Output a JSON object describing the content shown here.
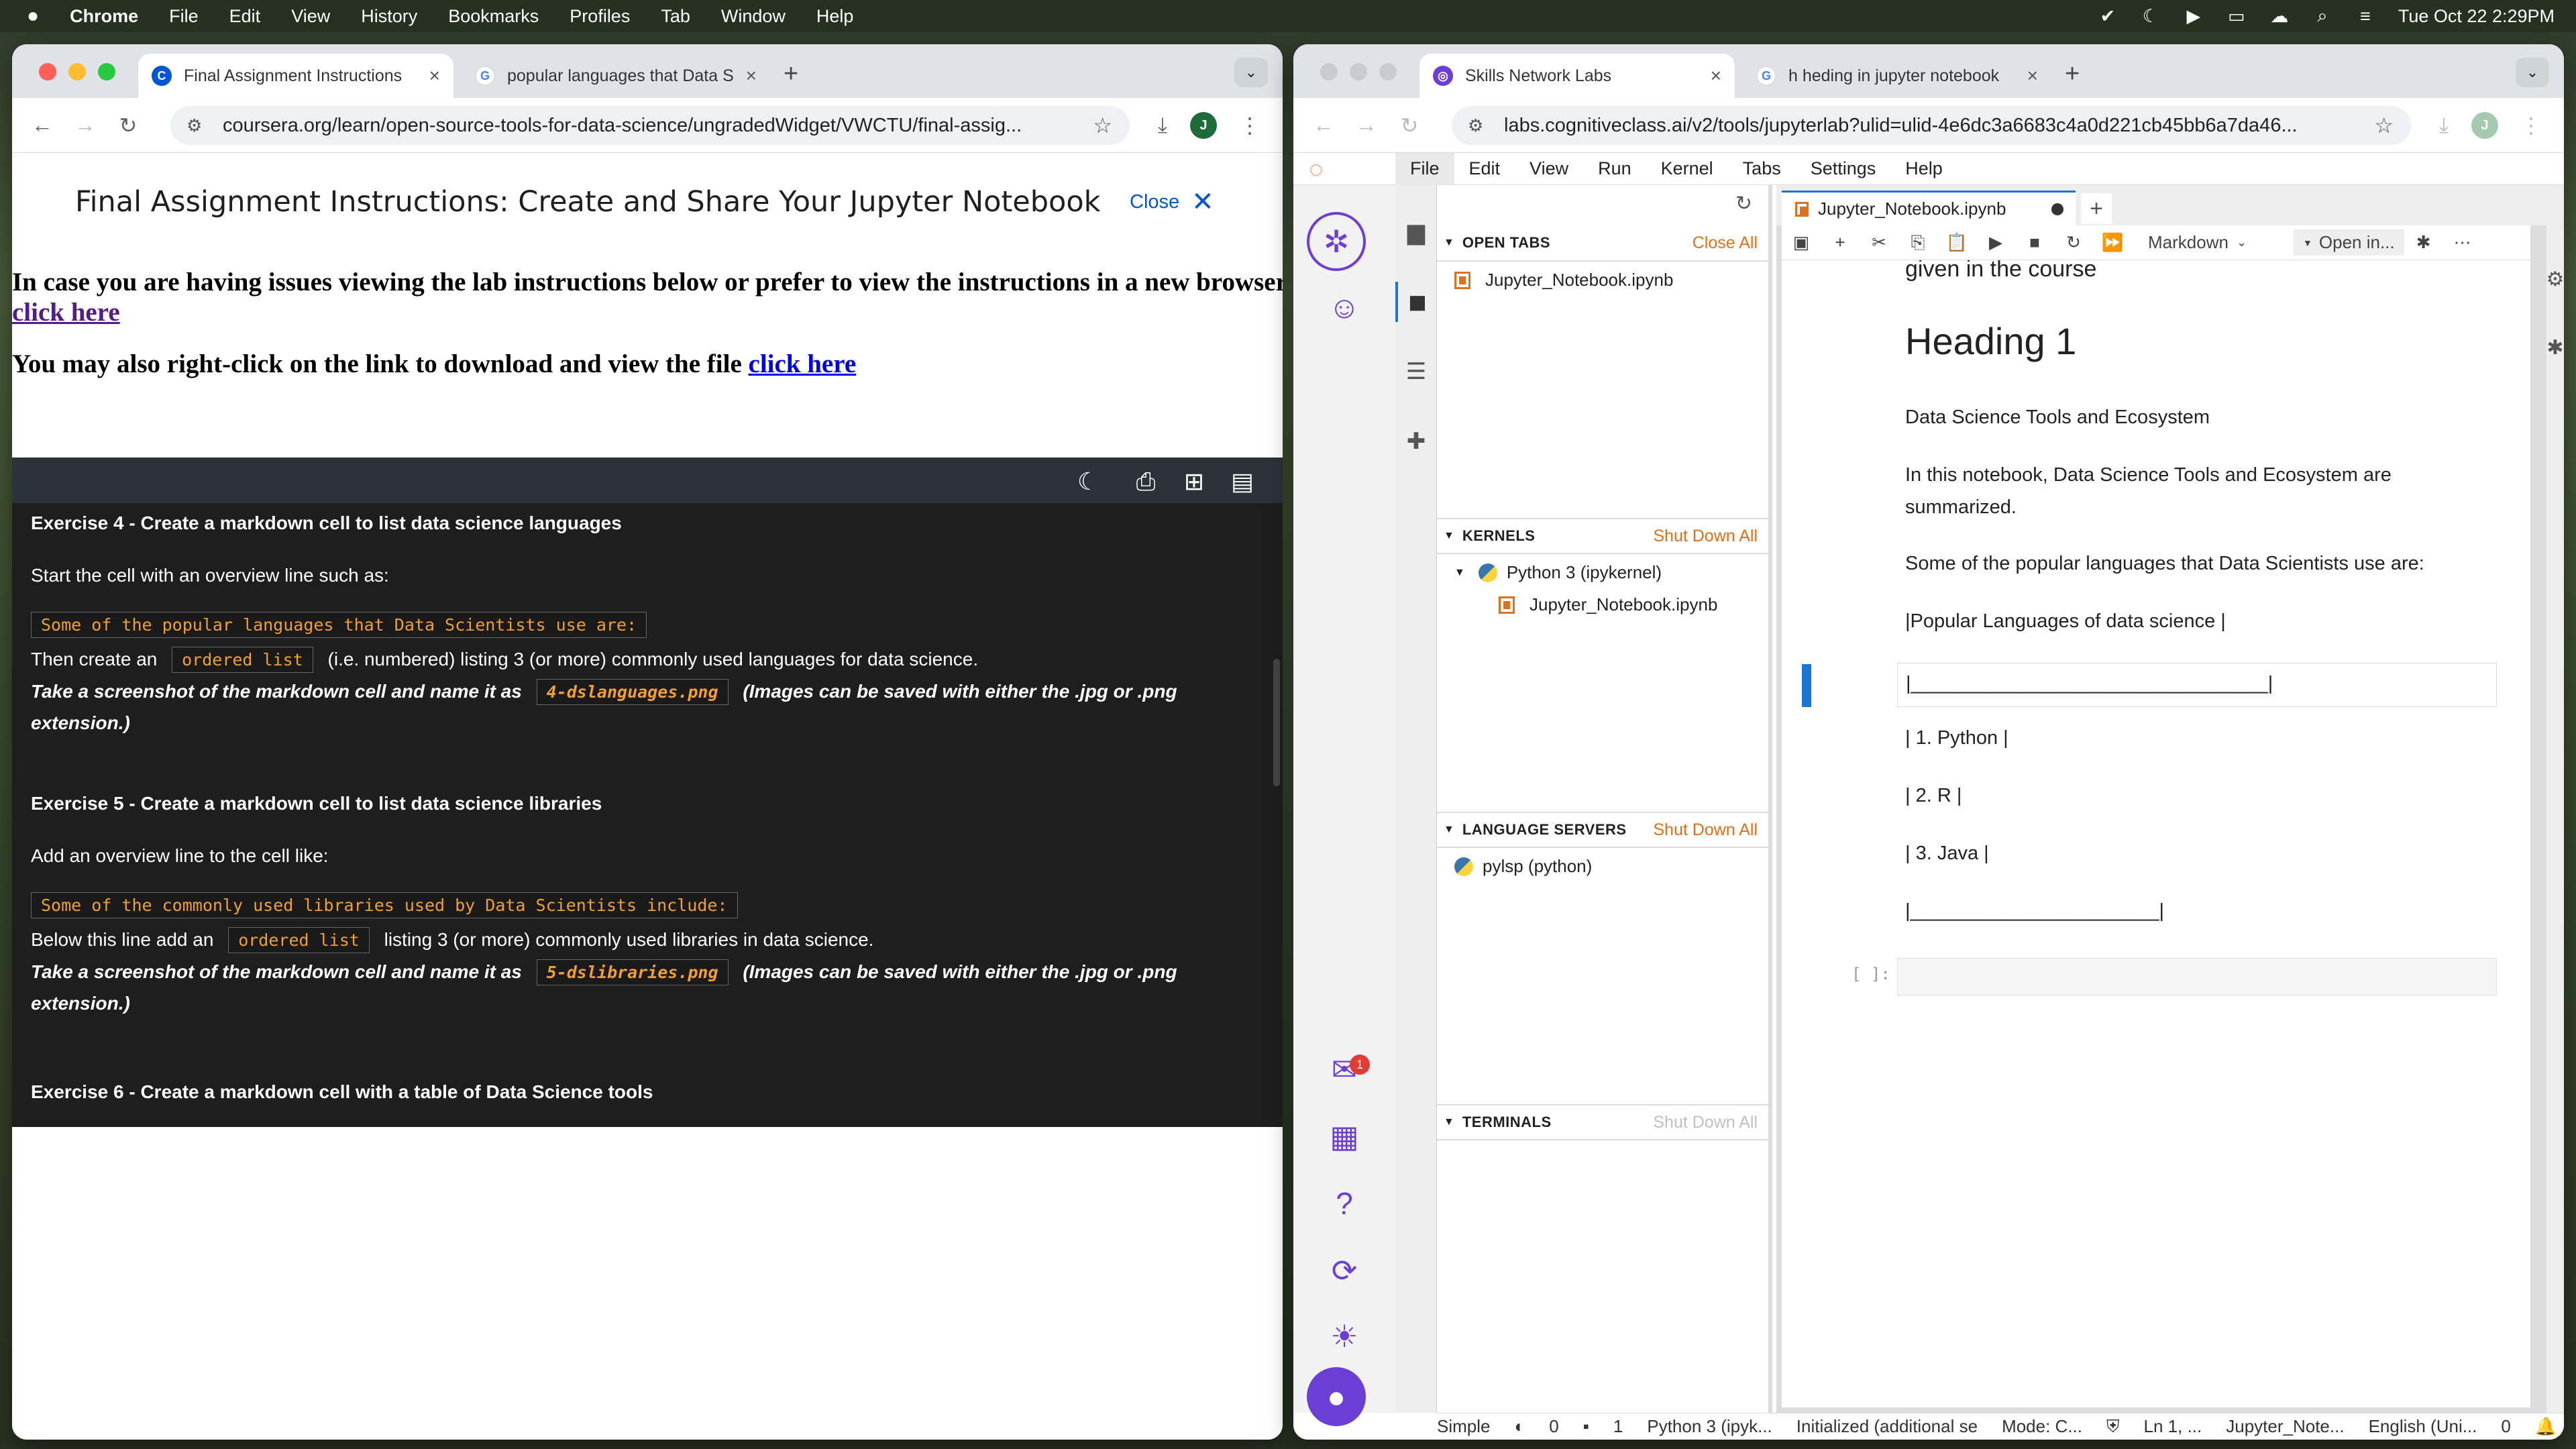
{
  "menubar": {
    "app": "Chrome",
    "items": [
      "File",
      "Edit",
      "View",
      "History",
      "Bookmarks",
      "Profiles",
      "Tab",
      "Window",
      "Help"
    ],
    "clock": "Tue Oct 22  2:29PM"
  },
  "left_window": {
    "tabs": [
      {
        "title": "Final Assignment Instructions",
        "favicon": "coursera-icon"
      },
      {
        "title": "popular languages that Data S",
        "favicon": "google-icon"
      }
    ],
    "url": "coursera.org/learn/open-source-tools-for-data-science/ungradedWidget/VWCTU/final-assig...",
    "profile_initial": "J",
    "page": {
      "title": "Final Assignment Instructions: Create and Share Your Jupyter Notebook",
      "close_label": "Close",
      "intro_text": "In case you are having issues viewing the lab instructions below or prefer to view the instructions in a new browser tab,",
      "intro_link": "click here",
      "download_text": "You may also right-click on the link to download and view the file ",
      "download_link": "click here",
      "ex4_heading": "Exercise 4 - Create a markdown cell to list data science languages",
      "ex4_start": "Start the cell with an overview line such as:",
      "ex4_code": "Some of the popular languages that Data Scientists use are:",
      "ex4_then_a": "Then create an",
      "ex4_then_code": "ordered list",
      "ex4_then_b": "(i.e. numbered) listing 3 (or more) commonly used languages for data science.",
      "ex4_shot_a": "Take a screenshot of the markdown cell and name it as",
      "ex4_shot_code": "4-dslanguages.png",
      "ex4_shot_b": "(Images can be saved with either the .jpg or .png",
      "ex4_shot_c": "extension.)",
      "ex5_heading": "Exercise 5 - Create a markdown cell to list data science libraries",
      "ex5_add": "Add an overview line to the cell like:",
      "ex5_code": "Some of the commonly used libraries used by Data Scientists include:",
      "ex5_below_a": "Below this line add an",
      "ex5_below_code": "ordered list",
      "ex5_below_b": "listing 3 (or more) commonly used libraries in data science.",
      "ex5_shot_a": "Take a screenshot of the markdown cell and name it as",
      "ex5_shot_code": "5-dslibraries.png",
      "ex5_shot_b": "(Images can be saved with either the .jpg or .png",
      "ex5_shot_c": "extension.)",
      "ex6_heading": "Exercise 6 - Create a markdown cell with a table of Data Science tools"
    }
  },
  "right_window": {
    "tabs": [
      {
        "title": "Skills Network Labs",
        "favicon": "skills-network-icon"
      },
      {
        "title": "h heding in jupyter notebook",
        "favicon": "google-icon"
      }
    ],
    "url": "labs.cognitiveclass.ai/v2/tools/jupyterlab?ulid=ulid-4e6dc3a6683c4a0d221cb45bb6a7da46...",
    "profile_initial": "J",
    "jupyter": {
      "menu": [
        "File",
        "Edit",
        "View",
        "Run",
        "Kernel",
        "Tabs",
        "Settings",
        "Help"
      ],
      "open_tabs_label": "OPEN TABS",
      "close_all": "Close All",
      "open_file": "Jupyter_Notebook.ipynb",
      "kernels_label": "KERNELS",
      "shut_down_all": "Shut Down All",
      "kernel_name": "Python 3 (ipykernel)",
      "kernel_file": "Jupyter_Notebook.ipynb",
      "lang_servers_label": "LANGUAGE SERVERS",
      "lang_server": "pylsp (python)",
      "terminals_label": "TERMINALS",
      "notebook_tab": "Jupyter_Notebook.ipynb",
      "cell_type": "Markdown",
      "open_in": "Open in...",
      "inbox_badge": "1",
      "cells": {
        "partial": "given in the course",
        "heading": "Heading 1",
        "line1": "Data Science Tools and Ecosystem",
        "line2a": "In this notebook, Data Science Tools and Ecosystem are",
        "line2b": "summarized.",
        "line3": "Some of the popular languages that Data Scientists use are:",
        "table_header": "|Popular Languages of data science |",
        "active_cell": "|_________________________________|",
        "item1": "| 1. Python |",
        "item2": "| 2. R |",
        "item3": "| 3. Java |",
        "table_end": "|_______________________|",
        "prompt": "[ ]:"
      },
      "status": {
        "mode_simple": "Simple",
        "count1": "0",
        "count2": "1",
        "kernel": "Python 3 (ipyk...",
        "lsp": "Initialized (additional se",
        "mode": "Mode: C...",
        "position": "Ln 1, ...",
        "file": "Jupyter_Note...",
        "language": "English (Uni...",
        "notifications": "0"
      }
    }
  }
}
